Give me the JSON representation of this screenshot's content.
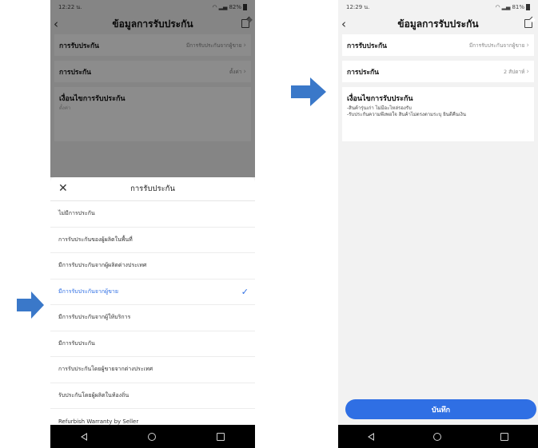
{
  "colors": {
    "accent": "#2f6fe4",
    "arrow": "#3a78c9"
  },
  "left_screen": {
    "status": {
      "time": "12:22 น.",
      "battery": "82%"
    },
    "title": "ข้อมูลการรับประกัน",
    "rows": [
      {
        "label": "การรับประกัน",
        "value": "มีการรับประกันจากผู้ขาย"
      },
      {
        "label": "การประกัน",
        "value": "ตั้งค่า"
      }
    ],
    "conditions": {
      "title": "เงื่อนไขการรับประกัน",
      "placeholder": "ตั้งค่า"
    },
    "sheet": {
      "title": "การรับประกัน",
      "options": [
        {
          "label": "ไม่มีการประกัน"
        },
        {
          "label": "การรับประกันของผู้ผลิตในพื้นที่"
        },
        {
          "label": "มีการรับประกันจากผู้ผลิตต่างประเทศ"
        },
        {
          "label": "มีการรับประกันจากผู้ขาย"
        },
        {
          "label": "มีการรับประกันจากผู้ให้บริการ"
        },
        {
          "label": "มีการรับประกัน"
        },
        {
          "label": "การรับประกันโดยผู้ขายจากต่างประเทศ"
        },
        {
          "label": "รับประกันโดยผู้ผลิตในท้องถิ่น"
        },
        {
          "label": "Refurbish Warranty by Seller"
        }
      ],
      "selected_option": "มีการรับประกันจากผู้ขาย"
    }
  },
  "right_screen": {
    "status": {
      "time": "12:29 น.",
      "battery": "81%"
    },
    "title": "ข้อมูลการรับประกัน",
    "rows": [
      {
        "label": "การรับประกัน",
        "value": "มีการรับประกันจากผู้ขาย"
      },
      {
        "label": "การประกัน",
        "value": "2 สัปดาห์"
      }
    ],
    "conditions": {
      "title": "เงื่อนไขการรับประกัน",
      "lines": [
        "-สินค้ารุ่นเก่า ไม่มีอะไหล่รองรับ",
        "-รับประกันความพึงพอใจ สินค้าไม่ตรงตามระบุ ยินดีคืนเงิน"
      ]
    },
    "save_label": "บันทึก"
  }
}
